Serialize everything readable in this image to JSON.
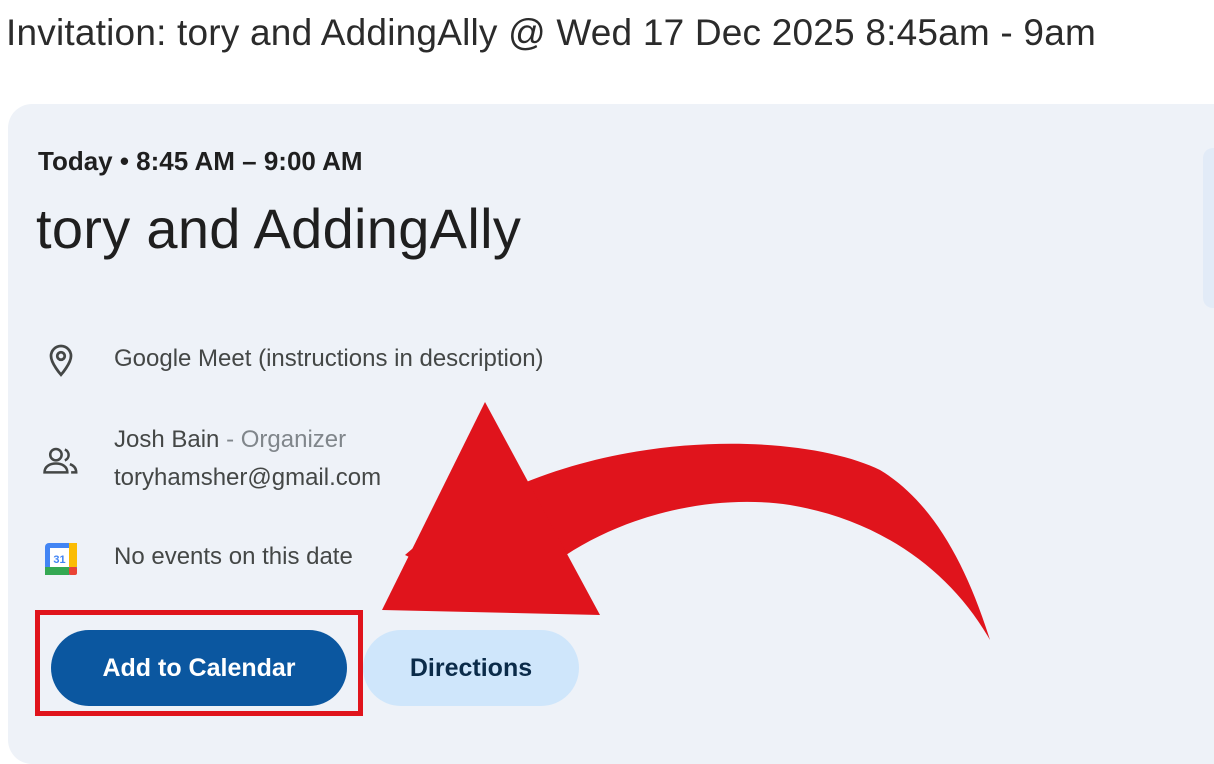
{
  "email": {
    "subject": "Invitation: tory and AddingAlly @ Wed 17 Dec 2025 8:45am - 9am"
  },
  "event": {
    "when": "Today • 8:45 AM – 9:00 AM",
    "title": "tory and AddingAlly",
    "location": "Google Meet (instructions in description)",
    "organizer_name": "Josh Bain",
    "organizer_role": " - Organizer",
    "organizer_email": "toryhamsher@gmail.com",
    "calendar_status": "No events on this date",
    "calendar_icon_day": "31"
  },
  "actions": {
    "add_to_calendar": "Add to Calendar",
    "directions": "Directions"
  },
  "annotation": {
    "arrow_color": "#e0141c",
    "highlight_color": "#e0141c"
  },
  "icons": {
    "location": "location-pin-icon",
    "people": "people-icon",
    "calendar": "google-calendar-icon"
  }
}
